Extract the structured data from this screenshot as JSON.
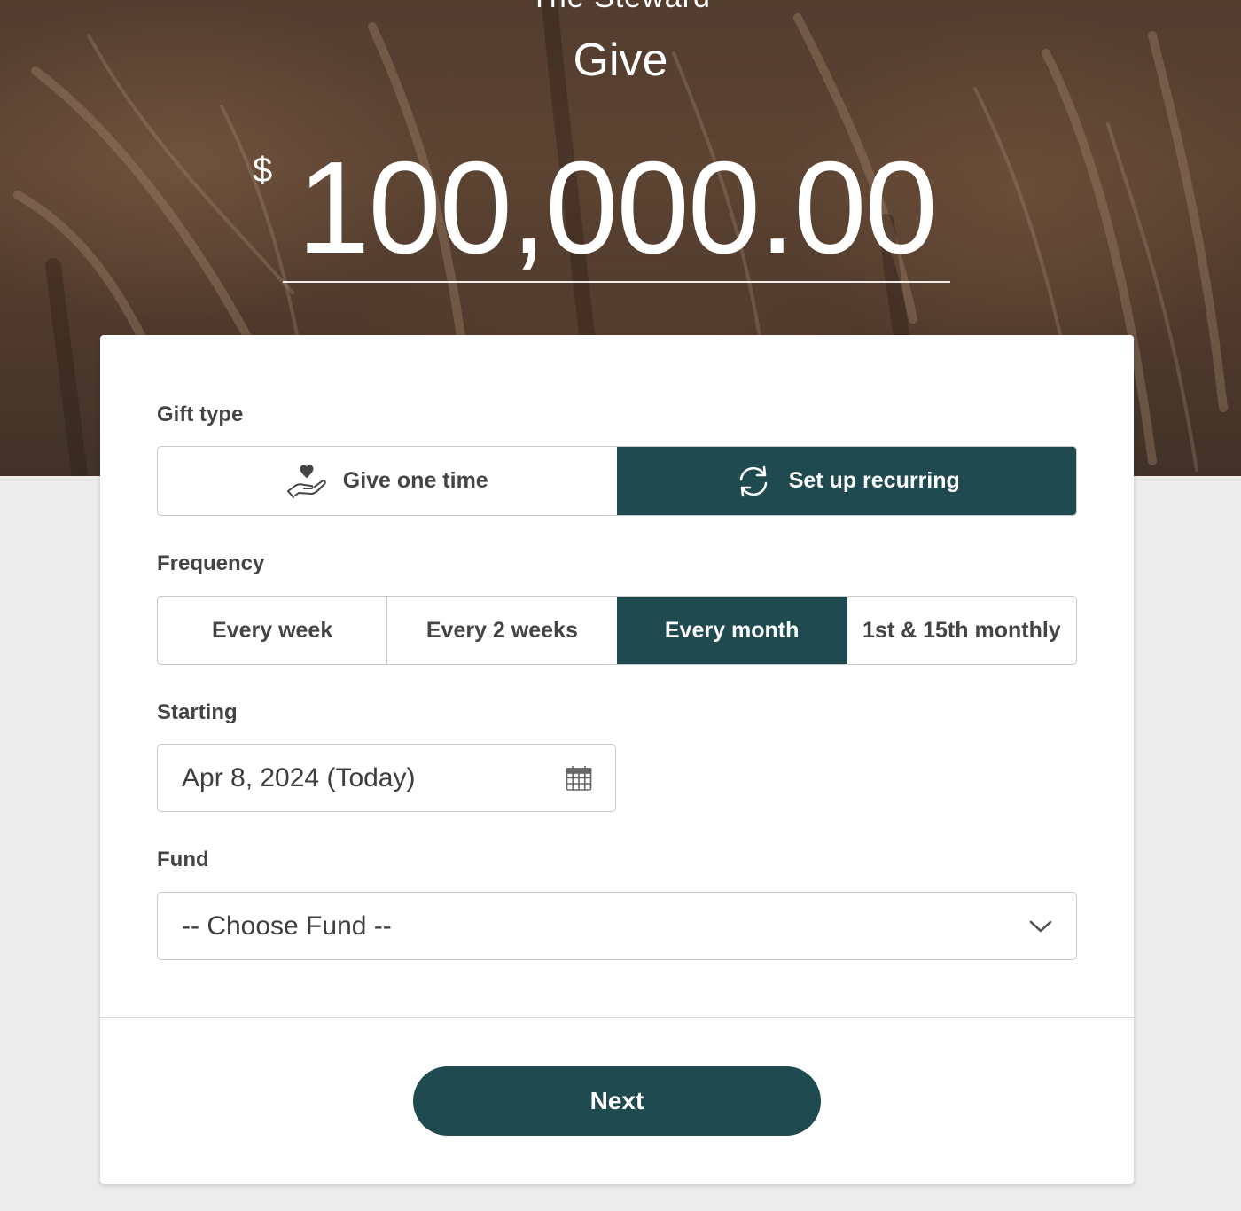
{
  "header": {
    "org_name": "The Steward",
    "title": "Give",
    "currency_symbol": "$",
    "amount": "100,000.00"
  },
  "gift_type": {
    "label": "Gift type",
    "options": [
      {
        "label": "Give one time",
        "icon": "hand-heart-icon",
        "selected": false
      },
      {
        "label": "Set up recurring",
        "icon": "refresh-icon",
        "selected": true
      }
    ]
  },
  "frequency": {
    "label": "Frequency",
    "options": [
      {
        "label": "Every week",
        "selected": false
      },
      {
        "label": "Every 2 weeks",
        "selected": false
      },
      {
        "label": "Every month",
        "selected": true
      },
      {
        "label": "1st & 15th monthly",
        "selected": false
      }
    ]
  },
  "starting": {
    "label": "Starting",
    "value": "Apr 8, 2024 (Today)",
    "icon": "calendar-icon"
  },
  "fund": {
    "label": "Fund",
    "value": "-- Choose Fund --",
    "icon": "chevron-down-icon"
  },
  "actions": {
    "next_label": "Next"
  },
  "colors": {
    "accent": "#1f4a50",
    "page_background": "#ececec",
    "card_background": "#ffffff"
  }
}
